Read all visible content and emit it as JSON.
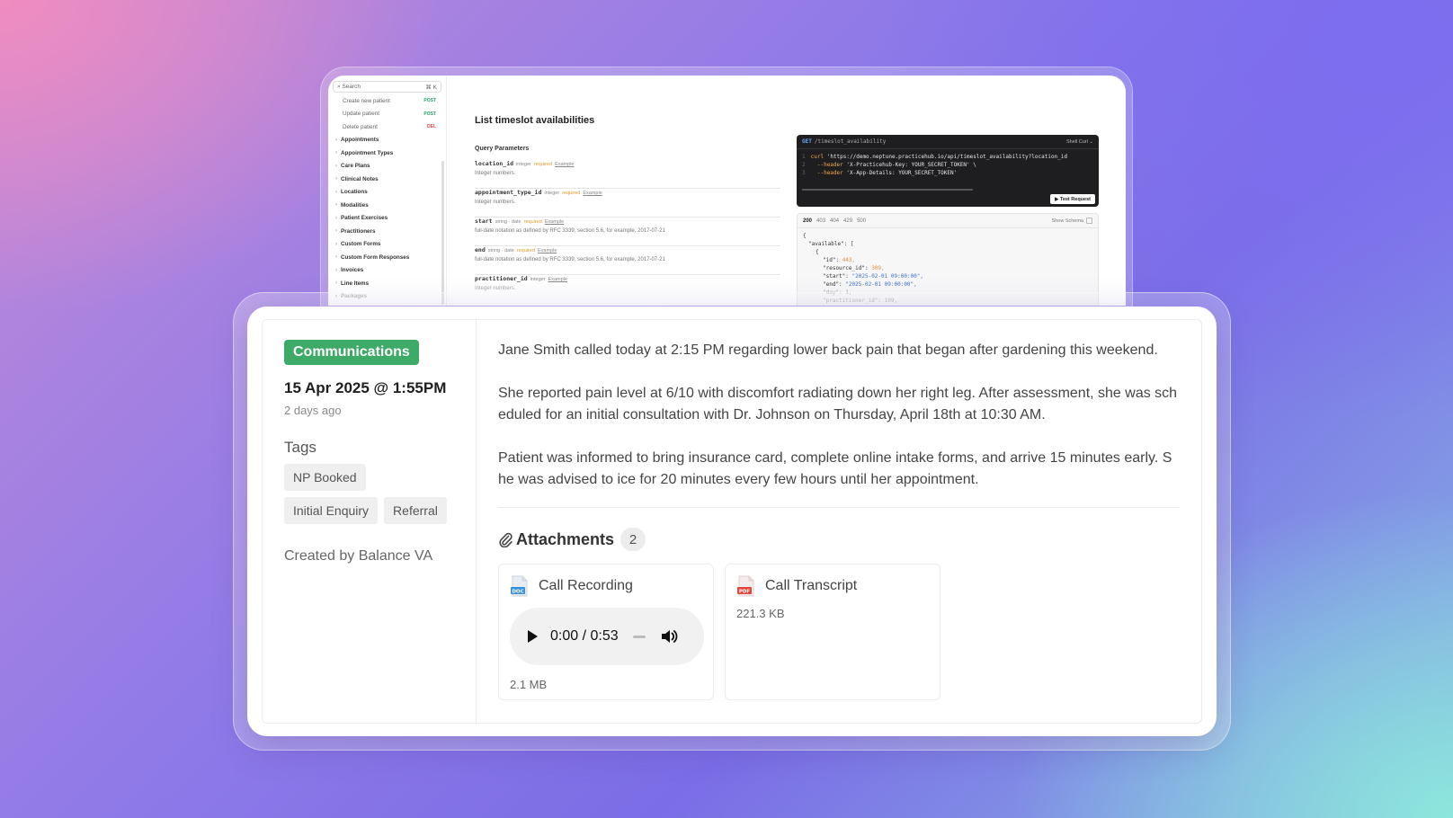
{
  "docs": {
    "search_placeholder": "Search",
    "search_shortcut": "⌘ K",
    "method_items": [
      {
        "label": "Create new patient",
        "method": "POST"
      },
      {
        "label": "Update patient",
        "method": "POST"
      },
      {
        "label": "Delete patient",
        "method": "DEL"
      }
    ],
    "groups": [
      "Appointments",
      "Appointment Types",
      "Care Plans",
      "Clinical Notes",
      "Locations",
      "Modalities",
      "Patient Exercises",
      "Practitioners",
      "Custom Forms",
      "Custom Form Responses",
      "Invoices",
      "Line Items",
      "Packages"
    ],
    "title": "List timeslot availabilities",
    "query_heading": "Query Parameters",
    "params": [
      {
        "name": "location_id",
        "type": "integer",
        "required": "required",
        "example": "Example",
        "desc": "Integer numbers."
      },
      {
        "name": "appointment_type_id",
        "type": "integer",
        "required": "required",
        "example": "Example",
        "desc": "Integer numbers."
      },
      {
        "name": "start",
        "type": "string · date",
        "required": "required",
        "example": "Example",
        "desc": "full-date notation as defined by RFC 3339, section 5.6, for example, 2017-07-21"
      },
      {
        "name": "end",
        "type": "string · date",
        "required": "required",
        "example": "Example",
        "desc": "full-date notation as defined by RFC 3339, section 5.6, for example, 2017-07-21"
      },
      {
        "name": "practitioner_id",
        "type": "integer",
        "required": "",
        "example": "Example",
        "desc": "Integer numbers."
      }
    ],
    "code": {
      "method": "GET",
      "path": "/timeslot_availability",
      "lang": "Shell Curl ⌄",
      "line1_cmd": "curl",
      "line1_url": "'https://demo.neptune.practicehub.io/api/timeslot_availability?location_id",
      "line2_flag": "--header",
      "line2_val": "'X-Practicehub-Key: YOUR_SECRET_TOKEN' \\",
      "line3_flag": "--header",
      "line3_val": "'X-App-Details: YOUR_SECRET_TOKEN'",
      "test_button": "▶ Test Request"
    },
    "response": {
      "codes": [
        "200",
        "403",
        "404",
        "429",
        "500"
      ],
      "show_schema": "Show Schema",
      "l1": "{",
      "l2": "\"available\": [",
      "l3": "{",
      "id_key": "\"id\": ",
      "id_val": "443,",
      "res_key": "\"resource_id\": ",
      "res_val": "309,",
      "start_key": "\"start\": ",
      "start_val": "\"2025-02-01 09:00:00\",",
      "end_key": "\"end\": ",
      "end_val": "\"2025-02-01 09:00:00\",",
      "day_key": "\"day\": ",
      "day_val": "1,",
      "prac_key": "\"practitioner_id\": ",
      "prac_val": "109,"
    }
  },
  "note": {
    "category": "Communications",
    "datetime": "15 Apr 2025 @ 1:55PM",
    "relative": "2 days ago",
    "tags_heading": "Tags",
    "tags_row1": [
      "NP Booked"
    ],
    "tags_row2": [
      "Initial Enquiry",
      "Referral"
    ],
    "created_by": "Created by Balance VA",
    "paragraphs": [
      "Jane Smith called today at 2:15 PM regarding lower back pain that began after gardening this weekend.",
      "She reported pain level at 6/10 with discomfort radiating down her right leg. After assessment, she was scheduled for an initial consultation with Dr. Johnson on Thursday, April 18th at 10:30 AM.",
      "Patient was informed to bring insurance card, complete online intake forms, and arrive 15 minutes early. She was advised to ice for 20 minutes every few hours until her appointment."
    ],
    "attachments_heading": "Attachments",
    "attachments_count": "2",
    "attachments": [
      {
        "title": "Call Recording",
        "icon": "doc-file-icon",
        "icon_label": "DOC",
        "time": "0:00 / 0:53",
        "size": "2.1 MB"
      },
      {
        "title": "Call Transcript",
        "icon": "pdf-file-icon",
        "icon_label": "PDF",
        "size": "221.3 KB"
      }
    ]
  },
  "colors": {
    "category_badge": "#3daa68",
    "doc_icon": "#3a8fd6",
    "pdf_icon": "#e0463b"
  }
}
